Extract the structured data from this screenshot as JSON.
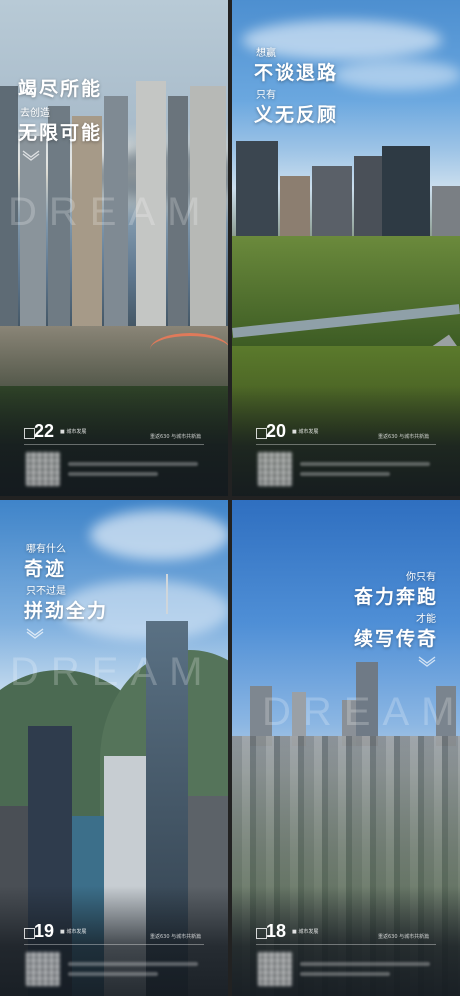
{
  "panels": [
    {
      "lines": [
        {
          "text": "竭尽所能",
          "size": "big"
        },
        {
          "text": "去创造",
          "size": "small"
        },
        {
          "text": "无限可能",
          "size": "big"
        }
      ],
      "watermark": "DREAM",
      "day": "22",
      "campaign_tag": "■ 城市发展",
      "countdown": "重返630 与城市共新篇"
    },
    {
      "lines": [
        {
          "text": "想赢",
          "size": "small"
        },
        {
          "text": "不谈退路",
          "size": "big"
        },
        {
          "text": "只有",
          "size": "small"
        },
        {
          "text": "义无反顾",
          "size": "big"
        }
      ],
      "watermark": "",
      "day": "20",
      "campaign_tag": "■ 城市发展",
      "countdown": "重返630 与城市共新篇"
    },
    {
      "lines": [
        {
          "text": "哪有什么",
          "size": "small"
        },
        {
          "text": "奇迹",
          "size": "big"
        },
        {
          "text": "只不过是",
          "size": "small"
        },
        {
          "text": "拼劲全力",
          "size": "big"
        }
      ],
      "watermark": "DREAM",
      "day": "19",
      "campaign_tag": "■ 城市发展",
      "countdown": "重返630 与城市共新篇"
    },
    {
      "lines": [
        {
          "text": "你只有",
          "size": "small"
        },
        {
          "text": "奋力奔跑",
          "size": "big"
        },
        {
          "text": "才能",
          "size": "small"
        },
        {
          "text": "续写传奇",
          "size": "big"
        }
      ],
      "watermark": "DREAM",
      "day": "18",
      "campaign_tag": "■ 城市发展",
      "countdown": "重返630 与城市共新篇"
    }
  ],
  "colors": {
    "text": "#ffffff",
    "footer_shade": "#141a20"
  },
  "icons": [
    "chevron-down-icon",
    "qr-code-icon",
    "calendar-square-icon"
  ]
}
